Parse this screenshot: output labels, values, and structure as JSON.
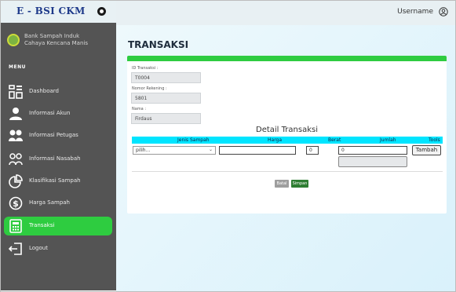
{
  "brand": {
    "title": "E - BSI CKM"
  },
  "org": {
    "line1": "Bank Sampah Induk",
    "line2": "Cahaya Kencana Manis"
  },
  "menu": {
    "title": "MENU",
    "items": [
      {
        "label": "Dashboard",
        "icon": "dashboard-icon"
      },
      {
        "label": "Informasi Akun",
        "icon": "user-icon"
      },
      {
        "label": "Informasi Petugas",
        "icon": "users-icon"
      },
      {
        "label": "Informasi Nasabah",
        "icon": "people-outline-icon"
      },
      {
        "label": "Klasifikasi Sampah",
        "icon": "pie-chart-icon"
      },
      {
        "label": "Harga Sampah",
        "icon": "dollar-icon"
      },
      {
        "label": "Transaksi",
        "icon": "calculator-icon",
        "active": true
      },
      {
        "label": "Logout",
        "icon": "logout-icon"
      }
    ]
  },
  "header": {
    "username": "Username"
  },
  "page": {
    "title": "TRANSAKSI"
  },
  "form": {
    "id_label": "ID Transaksi :",
    "id_value": "T0004",
    "rekening_label": "Nomor Rekening :",
    "rekening_value": "5801",
    "nama_label": "Nama :",
    "nama_value": "Firdaus"
  },
  "detail": {
    "title": "Detail Transaksi",
    "columns": [
      "Jenis Sampah",
      "Harga",
      "Berat",
      "Jumlah",
      "Tools"
    ],
    "row": {
      "jenis": "pilih...",
      "harga": "",
      "berat": "0",
      "jumlah": "0",
      "tambah_label": "Tambah"
    }
  },
  "actions": {
    "batal": "Batal",
    "simpan": "Simpan"
  },
  "colors": {
    "sidebar": "#545454",
    "active": "#2ecc40",
    "table_header": "#00e5ff",
    "save": "#2e7d32"
  }
}
